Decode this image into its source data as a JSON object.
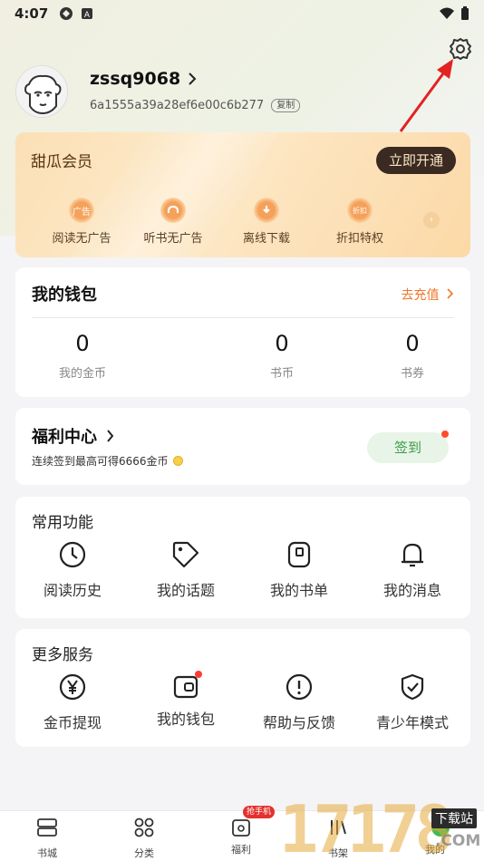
{
  "status_bar": {
    "time": "4:07"
  },
  "profile": {
    "username": "zssq9068",
    "uid": "6a1555a39a28ef6e00c6b277",
    "copy_label": "复制"
  },
  "vip": {
    "title": "甜瓜会员",
    "open_button": "立即开通",
    "benefits": [
      {
        "label": "阅读无广告",
        "icon": "ad-free-icon",
        "icon_text": "广告"
      },
      {
        "label": "听书无广告",
        "icon": "headphones-icon",
        "icon_text": ""
      },
      {
        "label": "离线下载",
        "icon": "download-icon",
        "icon_text": ""
      },
      {
        "label": "折扣特权",
        "icon": "discount-icon",
        "icon_text": "折扣"
      }
    ]
  },
  "wallet": {
    "title": "我的钱包",
    "recharge": "去充值",
    "stats": [
      {
        "value": "0",
        "label": "我的金币"
      },
      {
        "value": "0",
        "label": "书币"
      },
      {
        "value": "0",
        "label": "书券"
      }
    ]
  },
  "welfare": {
    "title": "福利中心",
    "description": "连续签到最高可得6666金币",
    "checkin": "签到"
  },
  "features": {
    "title": "常用功能",
    "items": [
      {
        "label": "阅读历史",
        "icon": "history-icon"
      },
      {
        "label": "我的话题",
        "icon": "tag-icon"
      },
      {
        "label": "我的书单",
        "icon": "booklist-icon"
      },
      {
        "label": "我的消息",
        "icon": "bell-icon"
      }
    ]
  },
  "services": {
    "title": "更多服务",
    "items": [
      {
        "label": "金币提现",
        "icon": "yen-icon"
      },
      {
        "label": "我的钱包",
        "icon": "wallet-icon"
      },
      {
        "label": "帮助与反馈",
        "icon": "help-icon"
      },
      {
        "label": "青少年模式",
        "icon": "shield-icon"
      }
    ]
  },
  "bottom_nav": {
    "items": [
      {
        "label": "书城"
      },
      {
        "label": "分类"
      },
      {
        "label": "福利",
        "badge": "抢手机"
      },
      {
        "label": "书架"
      },
      {
        "label": "我的"
      }
    ]
  },
  "watermark": {
    "digits": "17178",
    "tag": "下载站",
    "domain": ".COM"
  },
  "colors": {
    "accent_orange": "#f0762a",
    "checkin_green": "#3d9a49",
    "vip_dark": "#3a2a22"
  }
}
